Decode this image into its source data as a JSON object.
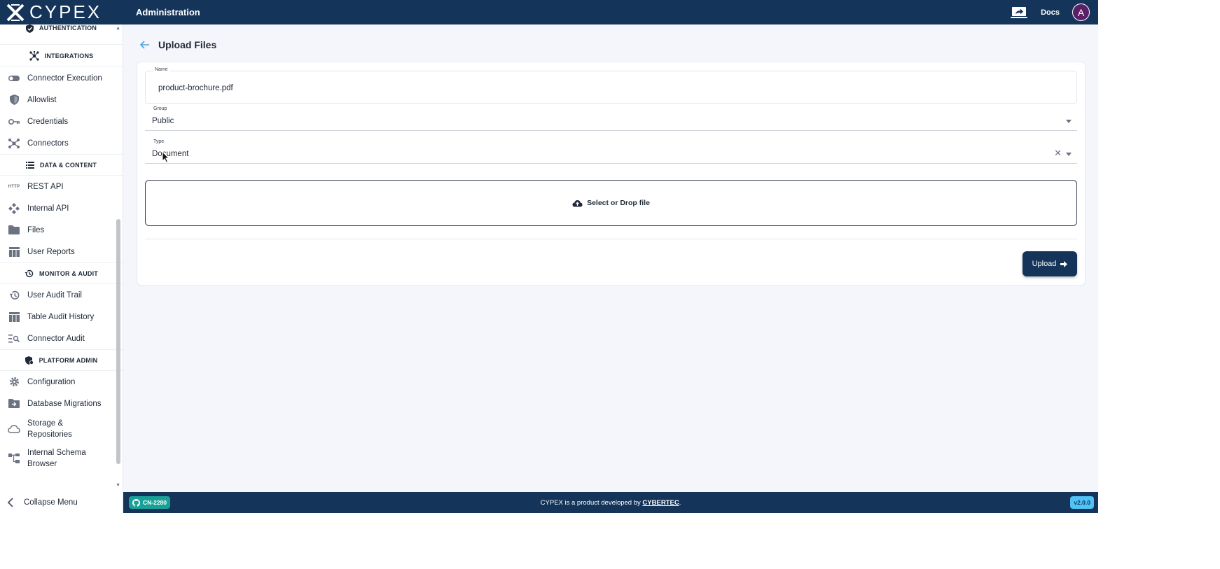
{
  "header": {
    "logo_text": "CYPEX",
    "title": "Administration",
    "docs_label": "Docs",
    "avatar_initial": "A",
    "screen_share_icon": "laptop-share-icon"
  },
  "sidebar": {
    "sections": {
      "authentication": "AUTHENTICATION",
      "integrations": "INTEGRATIONS",
      "data_content": "DATA & CONTENT",
      "monitor_audit": "MONITOR & AUDIT",
      "platform_admin": "PLATFORM ADMIN"
    },
    "items": {
      "connector_execution": "Connector Execution",
      "allowlist": "Allowlist",
      "credentials": "Credentials",
      "connectors": "Connectors",
      "rest_api": "REST API",
      "rest_api_icon_text": "HTTP",
      "internal_api": "Internal API",
      "files": "Files",
      "user_reports": "User Reports",
      "user_audit_trail": "User Audit Trail",
      "table_audit_history": "Table Audit History",
      "connector_audit": "Connector Audit",
      "configuration": "Configuration",
      "database_migrations": "Database Migrations",
      "storage_line1": "Storage &",
      "storage_line2": "Repositories",
      "schema_line1": "Internal Schema",
      "schema_line2": "Browser"
    },
    "collapse_label": "Collapse Menu"
  },
  "main": {
    "page_title": "Upload Files",
    "form": {
      "name_label": "Name",
      "name_value": "product-brochure.pdf",
      "group_label": "Group",
      "group_value": "Public",
      "type_label": "Type",
      "type_value": "Document",
      "dropzone_label": "Select or Drop file",
      "upload_label": "Upload"
    }
  },
  "footer": {
    "issue_badge": "CN-2280",
    "text_prefix": "CYPEX is a product developed by",
    "company_link": "CYBERTEC",
    "text_suffix": ".",
    "version": "v2.0.0"
  },
  "colors": {
    "brand_navy": "#14345a",
    "badge_teal": "#1aa197",
    "version_blue": "#4fc3f7",
    "back_arrow": "#4aa3df"
  }
}
